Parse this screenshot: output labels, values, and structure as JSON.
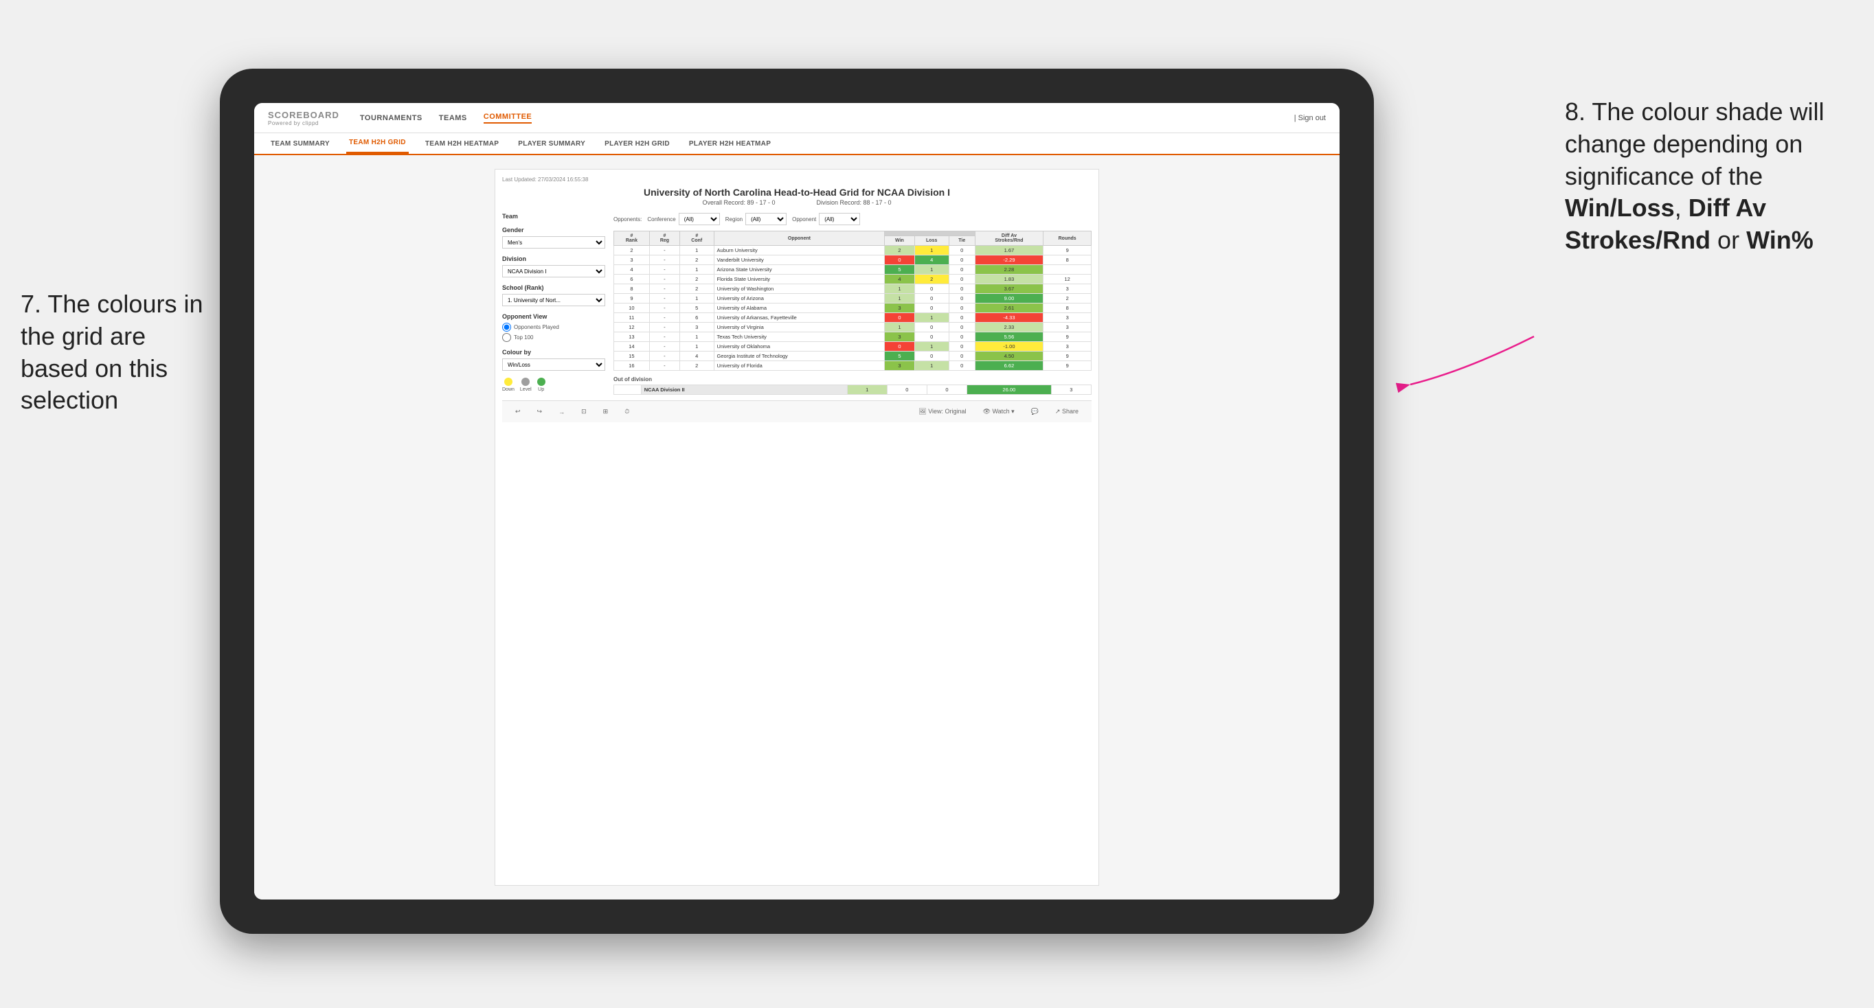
{
  "annotations": {
    "left": "7. The colours in the grid are based on this selection",
    "right_prefix": "8. The colour shade will change depending on significance of the ",
    "right_bold1": "Win/Loss",
    "right_sep1": ", ",
    "right_bold2": "Diff Av Strokes/Rnd",
    "right_sep2": " or ",
    "right_bold3": "Win%"
  },
  "nav": {
    "logo": "SCOREBOARD",
    "logo_sub": "Powered by clippd",
    "items": [
      "TOURNAMENTS",
      "TEAMS",
      "COMMITTEE"
    ],
    "sign_out": "Sign out"
  },
  "sub_nav": {
    "items": [
      "TEAM SUMMARY",
      "TEAM H2H GRID",
      "TEAM H2H HEATMAP",
      "PLAYER SUMMARY",
      "PLAYER H2H GRID",
      "PLAYER H2H HEATMAP"
    ],
    "active": "TEAM H2H GRID"
  },
  "tableau": {
    "last_updated": "Last Updated: 27/03/2024 16:55:38",
    "title": "University of North Carolina Head-to-Head Grid for NCAA Division I",
    "overall_record": "Overall Record: 89 - 17 - 0",
    "division_record": "Division Record: 88 - 17 - 0",
    "left_panel": {
      "team_label": "Team",
      "gender_label": "Gender",
      "gender_value": "Men's",
      "division_label": "Division",
      "division_value": "NCAA Division I",
      "school_label": "School (Rank)",
      "school_value": "1. University of Nort...",
      "opponent_view_label": "Opponent View",
      "opponent_played": "Opponents Played",
      "opponent_top100": "Top 100",
      "colour_by_label": "Colour by",
      "colour_by_value": "Win/Loss",
      "legend": {
        "down": "Down",
        "level": "Level",
        "up": "Up"
      }
    },
    "filters": {
      "opponents_label": "Opponents:",
      "conference_label": "Conference",
      "conference_value": "(All)",
      "region_label": "Region",
      "region_value": "(All)",
      "opponent_label": "Opponent",
      "opponent_value": "(All)"
    },
    "table": {
      "headers": {
        "rank": "#\nRank",
        "reg": "#\nReg",
        "conf": "#\nConf",
        "opponent": "Opponent",
        "win": "Win",
        "loss": "Loss",
        "tie": "Tie",
        "diff_av": "Diff Av\nStrokes/Rnd",
        "rounds": "Rounds"
      },
      "section_headers": {
        "conference": "Conference",
        "region": "Region",
        "opponent": "Opponent"
      },
      "rows": [
        {
          "rank": "2",
          "reg": "-",
          "conf": "1",
          "opponent": "Auburn University",
          "win": "2",
          "loss": "1",
          "tie": "0",
          "diff_av": "1.67",
          "rounds": "9",
          "win_color": "green_light",
          "loss_color": "yellow",
          "diff_color": "green_light"
        },
        {
          "rank": "3",
          "reg": "-",
          "conf": "2",
          "opponent": "Vanderbilt University",
          "win": "0",
          "loss": "4",
          "tie": "0",
          "diff_av": "-2.29",
          "rounds": "8",
          "win_color": "red",
          "loss_color": "green_dark",
          "diff_color": "red"
        },
        {
          "rank": "4",
          "reg": "-",
          "conf": "1",
          "opponent": "Arizona State University",
          "win": "5",
          "loss": "1",
          "tie": "0",
          "diff_av": "2.28",
          "rounds": "",
          "win_color": "green_dark",
          "loss_color": "green_light",
          "diff_color": "green_mid"
        },
        {
          "rank": "6",
          "reg": "-",
          "conf": "2",
          "opponent": "Florida State University",
          "win": "4",
          "loss": "2",
          "tie": "0",
          "diff_av": "1.83",
          "rounds": "12",
          "win_color": "green_mid",
          "loss_color": "yellow",
          "diff_color": "green_light"
        },
        {
          "rank": "8",
          "reg": "-",
          "conf": "2",
          "opponent": "University of Washington",
          "win": "1",
          "loss": "0",
          "tie": "0",
          "diff_av": "3.67",
          "rounds": "3",
          "win_color": "green_light",
          "loss_color": "white",
          "diff_color": "green_mid"
        },
        {
          "rank": "9",
          "reg": "-",
          "conf": "1",
          "opponent": "University of Arizona",
          "win": "1",
          "loss": "0",
          "tie": "0",
          "diff_av": "9.00",
          "rounds": "2",
          "win_color": "green_light",
          "loss_color": "white",
          "diff_color": "green_dark"
        },
        {
          "rank": "10",
          "reg": "-",
          "conf": "5",
          "opponent": "University of Alabama",
          "win": "3",
          "loss": "0",
          "tie": "0",
          "diff_av": "2.61",
          "rounds": "8",
          "win_color": "green_mid",
          "loss_color": "white",
          "diff_color": "green_mid"
        },
        {
          "rank": "11",
          "reg": "-",
          "conf": "6",
          "opponent": "University of Arkansas, Fayetteville",
          "win": "0",
          "loss": "1",
          "tie": "0",
          "diff_av": "-4.33",
          "rounds": "3",
          "win_color": "red",
          "loss_color": "green_light",
          "diff_color": "red"
        },
        {
          "rank": "12",
          "reg": "-",
          "conf": "3",
          "opponent": "University of Virginia",
          "win": "1",
          "loss": "0",
          "tie": "0",
          "diff_av": "2.33",
          "rounds": "3",
          "win_color": "green_light",
          "loss_color": "white",
          "diff_color": "green_light"
        },
        {
          "rank": "13",
          "reg": "-",
          "conf": "1",
          "opponent": "Texas Tech University",
          "win": "3",
          "loss": "0",
          "tie": "0",
          "diff_av": "5.56",
          "rounds": "9",
          "win_color": "green_mid",
          "loss_color": "white",
          "diff_color": "green_dark"
        },
        {
          "rank": "14",
          "reg": "-",
          "conf": "1",
          "opponent": "University of Oklahoma",
          "win": "0",
          "loss": "1",
          "tie": "0",
          "diff_av": "-1.00",
          "rounds": "3",
          "win_color": "red",
          "loss_color": "green_light",
          "diff_color": "yellow"
        },
        {
          "rank": "15",
          "reg": "-",
          "conf": "4",
          "opponent": "Georgia Institute of Technology",
          "win": "5",
          "loss": "0",
          "tie": "0",
          "diff_av": "4.50",
          "rounds": "9",
          "win_color": "green_dark",
          "loss_color": "white",
          "diff_color": "green_mid"
        },
        {
          "rank": "16",
          "reg": "-",
          "conf": "2",
          "opponent": "University of Florida",
          "win": "3",
          "loss": "1",
          "tie": "0",
          "diff_av": "6.62",
          "rounds": "9",
          "win_color": "green_mid",
          "loss_color": "green_light",
          "diff_color": "green_dark"
        }
      ],
      "out_of_division": {
        "label": "Out of division",
        "rows": [
          {
            "label": "NCAA Division II",
            "win": "1",
            "loss": "0",
            "tie": "0",
            "diff_av": "26.00",
            "rounds": "3",
            "win_color": "green_light",
            "loss_color": "white",
            "diff_color": "green_dark"
          }
        ]
      }
    },
    "toolbar": {
      "undo": "↩",
      "redo": "↪",
      "view": "⊡",
      "view_original": "View: Original",
      "watch": "Watch ▾",
      "share": "Share"
    }
  }
}
